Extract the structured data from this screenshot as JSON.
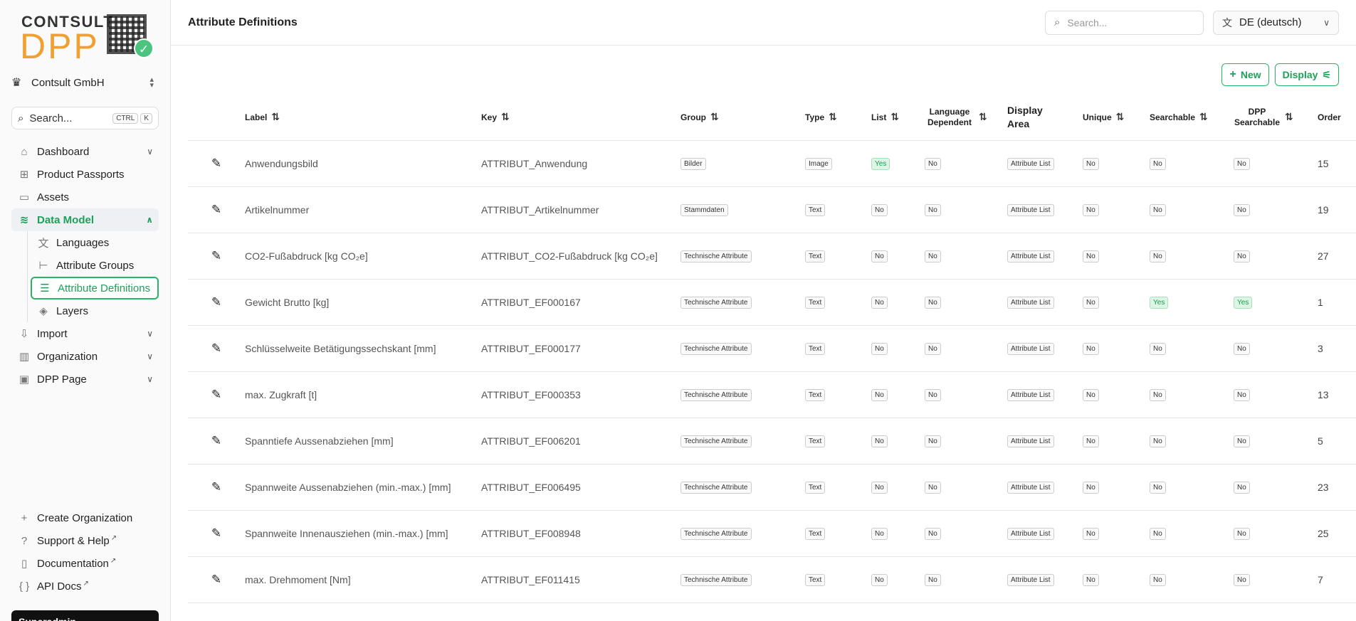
{
  "sidebar": {
    "logo_top": "CONTSULT",
    "logo_bottom": "DPP",
    "org_name": "Contsult GmbH",
    "search_label": "Search...",
    "search_kbd_1": "CTRL",
    "search_kbd_2": "K",
    "nav": {
      "dashboard": "Dashboard",
      "product_passports": "Product Passports",
      "assets": "Assets",
      "data_model": "Data Model",
      "languages": "Languages",
      "attribute_groups": "Attribute Groups",
      "attribute_definitions": "Attribute Definitions",
      "layers": "Layers",
      "import": "Import",
      "organization": "Organization",
      "dpp_page": "DPP Page"
    },
    "bottom": {
      "create_org": "Create Organization",
      "support": "Support & Help",
      "documentation": "Documentation",
      "api_docs": "API Docs"
    },
    "superadmin": "Superadmin"
  },
  "header": {
    "title": "Attribute Definitions",
    "search_placeholder": "Search...",
    "language": "DE (deutsch)"
  },
  "toolbar": {
    "new_label": "New",
    "display_label": "Display"
  },
  "table": {
    "headers": {
      "label": "Label",
      "key": "Key",
      "group": "Group",
      "type": "Type",
      "list": "List",
      "language_dependent": "Language Dependent",
      "display_area": "Display Area",
      "unique": "Unique",
      "searchable": "Searchable",
      "dpp_searchable": "DPP Searchable",
      "order": "Order"
    },
    "rows": [
      {
        "label": "Anwendungsbild",
        "key": "ATTRIBUT_Anwendung",
        "group": "Bilder",
        "type": "Image",
        "list": "Yes",
        "lang": "No",
        "area": "Attribute List",
        "unique": "No",
        "searchable": "No",
        "dpp": "No",
        "order": "15"
      },
      {
        "label": "Artikelnummer",
        "key": "ATTRIBUT_Artikelnummer",
        "group": "Stammdaten",
        "type": "Text",
        "list": "No",
        "lang": "No",
        "area": "Attribute List",
        "unique": "No",
        "searchable": "No",
        "dpp": "No",
        "order": "19"
      },
      {
        "label": "CO2-Fußabdruck [kg CO₂e]",
        "key": "ATTRIBUT_CO2-Fußabdruck [kg CO₂e]",
        "group": "Technische Attribute",
        "type": "Text",
        "list": "No",
        "lang": "No",
        "area": "Attribute List",
        "unique": "No",
        "searchable": "No",
        "dpp": "No",
        "order": "27"
      },
      {
        "label": "Gewicht Brutto [kg]",
        "key": "ATTRIBUT_EF000167",
        "group": "Technische Attribute",
        "type": "Text",
        "list": "No",
        "lang": "No",
        "area": "Attribute List",
        "unique": "No",
        "searchable": "Yes",
        "dpp": "Yes",
        "order": "1"
      },
      {
        "label": "Schlüsselweite Betätigungssechskant [mm]",
        "key": "ATTRIBUT_EF000177",
        "group": "Technische Attribute",
        "type": "Text",
        "list": "No",
        "lang": "No",
        "area": "Attribute List",
        "unique": "No",
        "searchable": "No",
        "dpp": "No",
        "order": "3"
      },
      {
        "label": "max. Zugkraft [t]",
        "key": "ATTRIBUT_EF000353",
        "group": "Technische Attribute",
        "type": "Text",
        "list": "No",
        "lang": "No",
        "area": "Attribute List",
        "unique": "No",
        "searchable": "No",
        "dpp": "No",
        "order": "13"
      },
      {
        "label": "Spanntiefe Aussenabziehen [mm]",
        "key": "ATTRIBUT_EF006201",
        "group": "Technische Attribute",
        "type": "Text",
        "list": "No",
        "lang": "No",
        "area": "Attribute List",
        "unique": "No",
        "searchable": "No",
        "dpp": "No",
        "order": "5"
      },
      {
        "label": "Spannweite Aussenabziehen (min.-max.) [mm]",
        "key": "ATTRIBUT_EF006495",
        "group": "Technische Attribute",
        "type": "Text",
        "list": "No",
        "lang": "No",
        "area": "Attribute List",
        "unique": "No",
        "searchable": "No",
        "dpp": "No",
        "order": "23"
      },
      {
        "label": "Spannweite Innenausziehen (min.-max.) [mm]",
        "key": "ATTRIBUT_EF008948",
        "group": "Technische Attribute",
        "type": "Text",
        "list": "No",
        "lang": "No",
        "area": "Attribute List",
        "unique": "No",
        "searchable": "No",
        "dpp": "No",
        "order": "25"
      },
      {
        "label": "max. Drehmoment [Nm]",
        "key": "ATTRIBUT_EF011415",
        "group": "Technische Attribute",
        "type": "Text",
        "list": "No",
        "lang": "No",
        "area": "Attribute List",
        "unique": "No",
        "searchable": "No",
        "dpp": "No",
        "order": "7"
      }
    ]
  }
}
